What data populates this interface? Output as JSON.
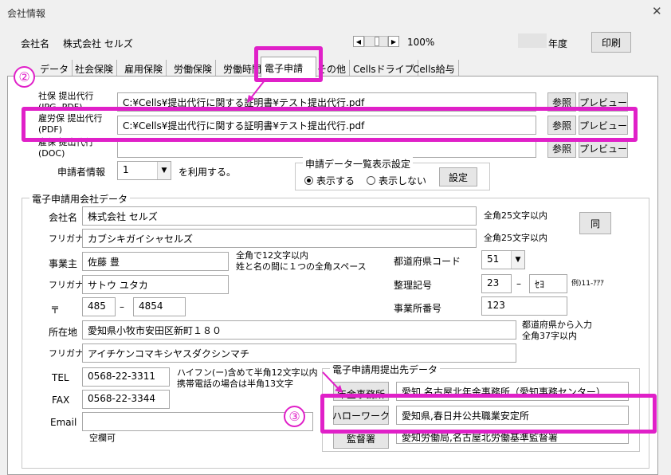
{
  "window": {
    "title": "会社情報",
    "close_glyph": "✕"
  },
  "header": {
    "company_label": "会社名",
    "company_name": "株式会社 セルズ",
    "zoom": "100%",
    "year_label": "年度",
    "print_label": "印刷"
  },
  "tabs": [
    {
      "label": "データ"
    },
    {
      "label": "社会保険"
    },
    {
      "label": "雇用保険"
    },
    {
      "label": "労働保険"
    },
    {
      "label": "労働時間"
    },
    {
      "label": "電子申請"
    },
    {
      "label": "その他"
    },
    {
      "label": "Cellsドライブ"
    },
    {
      "label": "Cells給与"
    }
  ],
  "delegate": {
    "rows": [
      {
        "label": "社保 提出代行\n(JPG, PDF)",
        "value": "C:¥Cells¥提出代行に関する証明書¥テスト提出代行.pdf",
        "browse": "参照",
        "preview": "プレビュー"
      },
      {
        "label": "雇労保 提出代行\n(PDF)",
        "value": "C:¥Cells¥提出代行に関する証明書¥テスト提出代行.pdf",
        "browse": "参照",
        "preview": "プレビュー"
      },
      {
        "label": "雇保 提出代行\n(DOC)",
        "value": "",
        "browse": "参照",
        "preview": "プレビュー"
      }
    ],
    "applicant_label": "申請者情報",
    "applicant_value": "1",
    "applicant_suffix": "を利用する。"
  },
  "list_display": {
    "title": "申請データ一覧表示設定",
    "show": "表示する",
    "hide": "表示しない",
    "settings_button": "設定"
  },
  "company_data": {
    "title": "電子申請用会社データ",
    "name_label": "会社名",
    "name_value": "株式会社 セルズ",
    "name_note": "全角25文字以内",
    "furigana_label": "フリガナ",
    "furigana_value": "カブシキガイシャセルズ",
    "furigana_note": "全角25文字以内",
    "same_button": "同",
    "owner_label": "事業主",
    "owner_value": "佐藤 豊",
    "owner_note1": "全角で12文字以内",
    "owner_note2": "姓と名の間に１つの全角スペース",
    "owner_kana_label": "フリガナ",
    "owner_kana_value": "サトウ ユタカ",
    "zip_label": "〒",
    "zip1": "485",
    "zip_dash": "–",
    "zip2": "4854",
    "address_label": "所在地",
    "address_value": "愛知県小牧市安田区新町１８０",
    "address_note1": "都道府県から入力",
    "address_note2": "全角37字以内",
    "address_kana_label": "フリガナ",
    "address_kana_value": "アイチケンコマキシヤスダクシンマチ",
    "tel_label": "TEL",
    "tel_value": "0568-22-3311",
    "tel_note1": "ハイフン(ー)含めて半角12文字以内",
    "tel_note2": "携帯電話の場合は半角13文字",
    "fax_label": "FAX",
    "fax_value": "0568-22-3344",
    "email_label": "Email",
    "email_value": "",
    "email_note": "空欄可",
    "pref_label": "都道府県コード",
    "pref_value": "51",
    "reg_label": "整理記号",
    "reg1": "23",
    "reg_dash": "–",
    "reg2": "ｾﾖ",
    "reg_example": "例)11-ｱｱｱ",
    "office_label": "事業所番号",
    "office_value": "123"
  },
  "destination": {
    "title": "電子申請用提出先データ",
    "rows": [
      {
        "button": "年金事務所",
        "value": "愛知,名古屋北年金事務所（愛知事務センター）"
      },
      {
        "button": "ハローワーク",
        "value": "愛知県,春日井公共職業安定所"
      },
      {
        "button": "監督署",
        "value": "愛知労働局,名古屋北労働基準監督署"
      }
    ]
  },
  "annotations": {
    "marker2": "②",
    "marker3": "③"
  },
  "colors": {
    "highlight": "#e020c8"
  }
}
